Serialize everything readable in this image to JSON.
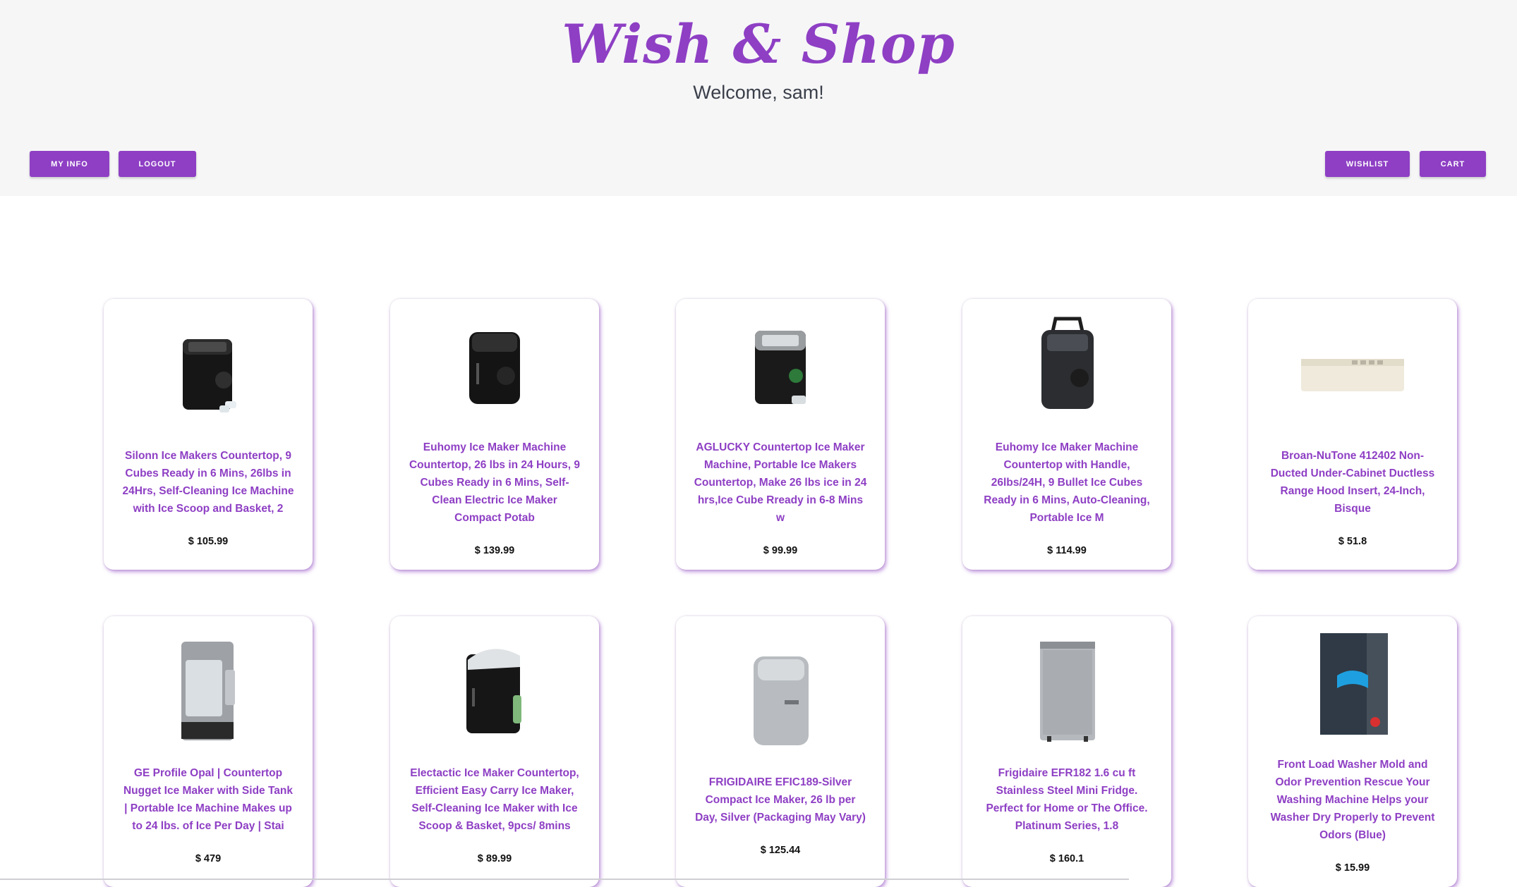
{
  "header": {
    "logo": "Wish & Shop",
    "welcome": "Welcome, sam!",
    "buttons": {
      "my_info": "MY INFO",
      "logout": "LOGOUT",
      "wishlist": "WISHLIST",
      "cart": "CART"
    }
  },
  "colors": {
    "accent": "#8e3fc4",
    "header_bg": "#f6f6f7"
  },
  "products": [
    {
      "title": "Silonn Ice Makers Countertop, 9 Cubes Ready in 6 Mins, 26lbs in 24Hrs, Self-Cleaning Ice Machine with Ice Scoop and Basket, 2",
      "price": "$ 105.99",
      "image": "black-ice-maker-image"
    },
    {
      "title": "Euhomy Ice Maker Machine Countertop, 26 lbs in 24 Hours, 9 Cubes Ready in 6 Mins, Self-Clean Electric Ice Maker Compact Potab",
      "price": "$ 139.99",
      "image": "black-ice-maker-image"
    },
    {
      "title": "AGLUCKY Countertop Ice Maker Machine, Portable Ice Makers Countertop, Make 26 lbs ice in 24 hrs,Ice Cube Rready in 6-8 Mins w",
      "price": "$ 99.99",
      "image": "black-silver-ice-maker-image"
    },
    {
      "title": "Euhomy Ice Maker Machine Countertop with Handle, 26lbs/24H, 9 Bullet Ice Cubes Ready in 6 Mins, Auto-Cleaning, Portable Ice M",
      "price": "$ 114.99",
      "image": "ice-maker-with-handle-image"
    },
    {
      "title": "Broan-NuTone 412402 Non-Ducted Under-Cabinet Ductless Range Hood Insert, 24-Inch, Bisque",
      "price": "$ 51.8",
      "image": "range-hood-image"
    },
    {
      "title": "GE Profile Opal | Countertop Nugget Ice Maker with Side Tank | Portable Ice Machine Makes up to 24 lbs. of Ice Per Day | Stai",
      "price": "$ 479",
      "image": "stainless-ice-maker-image"
    },
    {
      "title": "Electactic Ice Maker Countertop, Efficient Easy Carry Ice Maker, Self-Cleaning Ice Maker with Ice Scoop & Basket, 9pcs/ 8mins",
      "price": "$ 89.99",
      "image": "black-ice-maker-open-image"
    },
    {
      "title": "FRIGIDAIRE EFIC189-Silver Compact Ice Maker, 26 lb per Day, Silver (Packaging May Vary)",
      "price": "$ 125.44",
      "image": "silver-ice-maker-image"
    },
    {
      "title": "Frigidaire EFR182 1.6 cu ft Stainless Steel Mini Fridge. Perfect for Home or The Office. Platinum Series, 1.8",
      "price": "$ 160.1",
      "image": "mini-fridge-image"
    },
    {
      "title": "Front Load Washer Mold and Odor Prevention Rescue Your Washing Machine Helps your Washer Dry Properly to Prevent Odors (Blue)",
      "price": "$ 15.99",
      "image": "washer-door-prop-image"
    }
  ]
}
